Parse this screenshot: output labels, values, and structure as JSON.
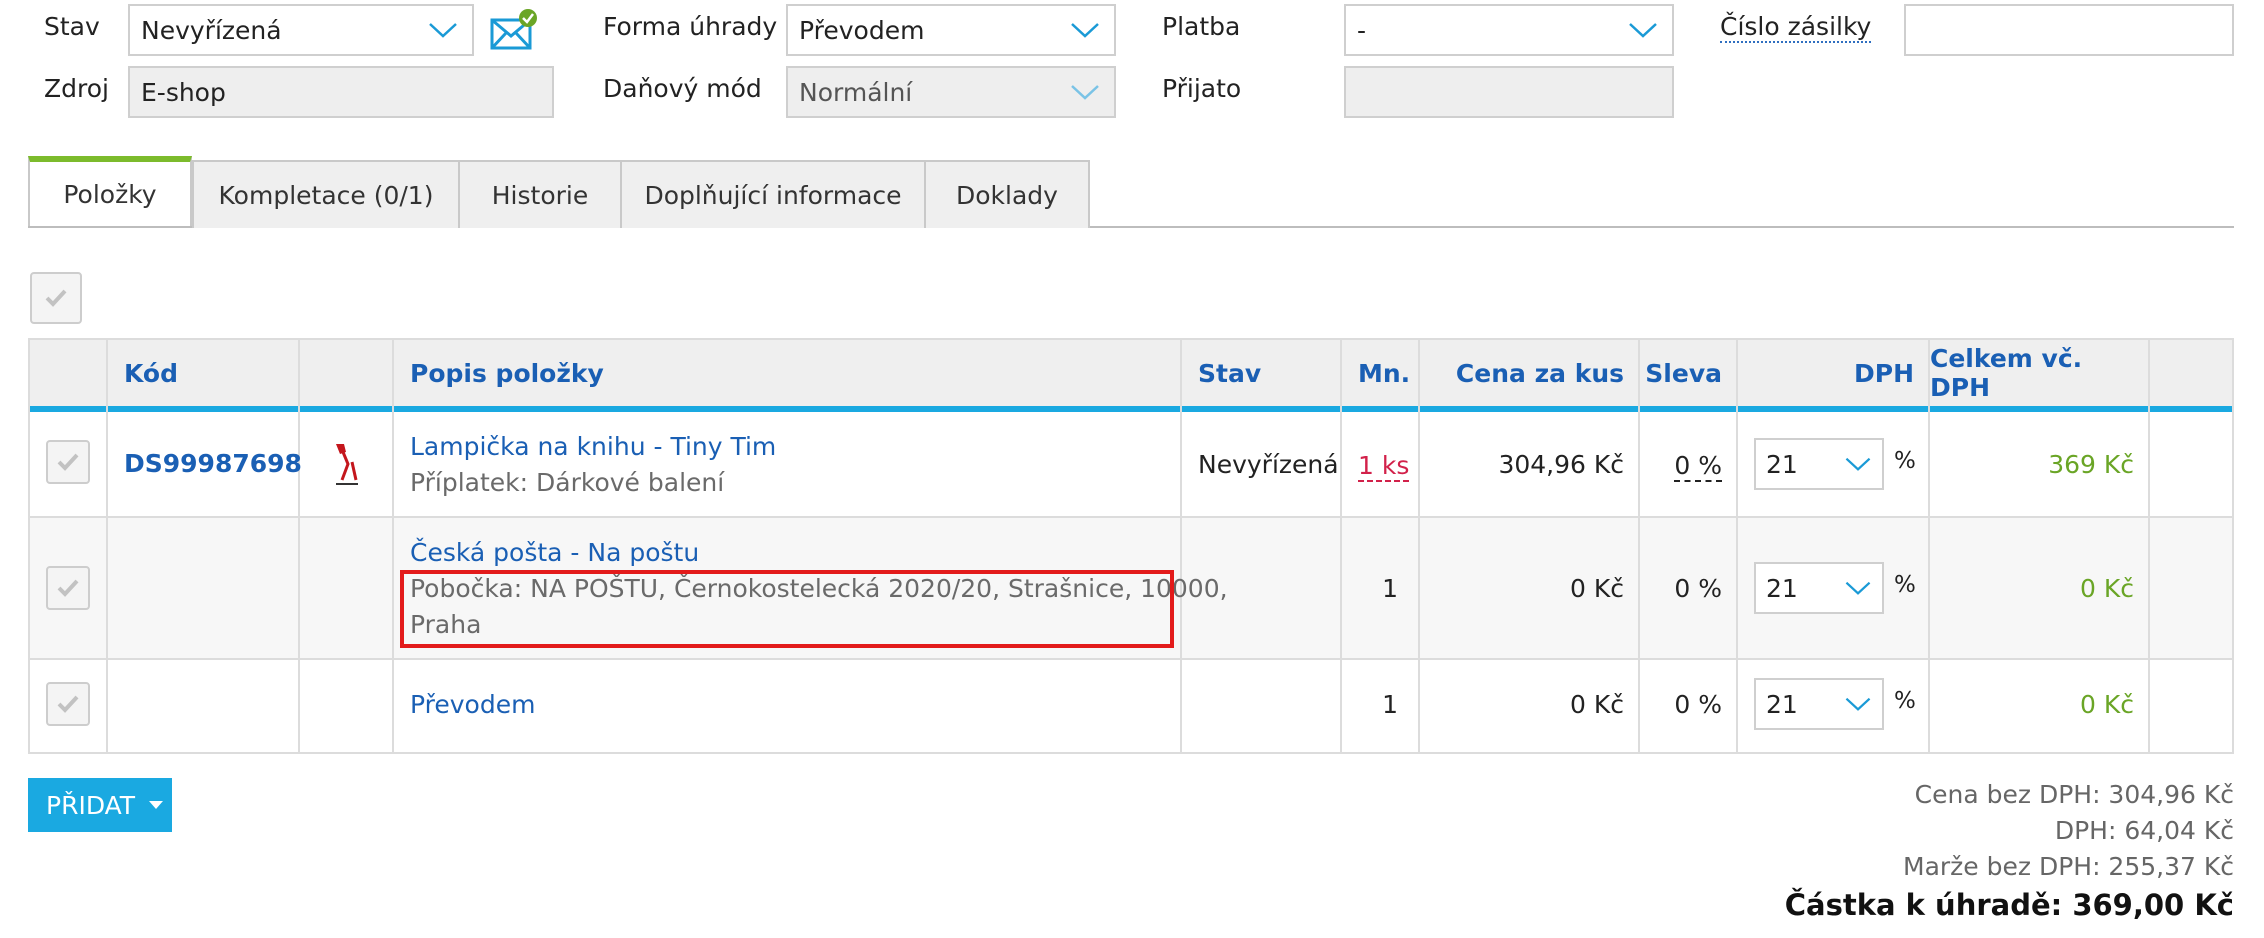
{
  "form": {
    "stav": {
      "label": "Stav",
      "value": "Nevyřízená"
    },
    "zdroj": {
      "label": "Zdroj",
      "value": "E-shop"
    },
    "forma_uhrady": {
      "label": "Forma úhrady",
      "value": "Převodem"
    },
    "danovy_mod": {
      "label": "Daňový mód",
      "value": "Normální"
    },
    "platba": {
      "label": "Platba",
      "value": "-"
    },
    "prijato": {
      "label": "Přijato",
      "value": ""
    },
    "cislo_zasilky": {
      "label": "Číslo zásilky",
      "value": ""
    },
    "email_icon": "envelope-check-icon"
  },
  "tabs": [
    {
      "label": "Položky",
      "active": true
    },
    {
      "label": "Kompletace (0/1)"
    },
    {
      "label": "Historie"
    },
    {
      "label": "Doplňující informace"
    },
    {
      "label": "Doklady"
    }
  ],
  "table": {
    "headers": {
      "kod": "Kód",
      "popis": "Popis položky",
      "stav": "Stav",
      "mn": "Mn.",
      "cena": "Cena za kus",
      "sleva": "Sleva",
      "dph": "DPH",
      "celkem": "Celkem vč. DPH"
    },
    "rows": [
      {
        "code": "DS99987698",
        "title": "Lampička na knihu - Tiny Tim",
        "subtitle": "Příplatek: Dárkové balení",
        "stav": "Nevyřízená",
        "qty": "1 ks",
        "price": "304,96 Kč",
        "discount": "0 %",
        "vat": "21",
        "vat_unit": "%",
        "total": "369 Kč"
      },
      {
        "code": "",
        "title": "Česká pošta - Na poštu",
        "subtitle_line1": "Pobočka: NA POŠTU, Černokostelecká 2020/20, Strašnice, 10000,",
        "subtitle_line2": "Praha",
        "stav": "",
        "qty": "1",
        "price": "0 Kč",
        "discount": "0 %",
        "vat": "21",
        "vat_unit": "%",
        "total": "0 Kč"
      },
      {
        "code": "",
        "title": "Převodem",
        "stav": "",
        "qty": "1",
        "price": "0 Kč",
        "discount": "0 %",
        "vat": "21",
        "vat_unit": "%",
        "total": "0 Kč"
      }
    ]
  },
  "add_button": "PŘIDAT",
  "summary": {
    "cena_bez_dph": "Cena bez DPH: 304,96 Kč",
    "dph": "DPH: 64,04 Kč",
    "marze": "Marže bez DPH: 255,37 Kč",
    "castka": "Částka k úhradě: 369,00 Kč"
  },
  "colors": {
    "link": "#1a5fb4",
    "accent": "#1aa9e1",
    "green": "#6aa526",
    "highlight": "#e31b1b",
    "qty_red": "#d2214a"
  }
}
